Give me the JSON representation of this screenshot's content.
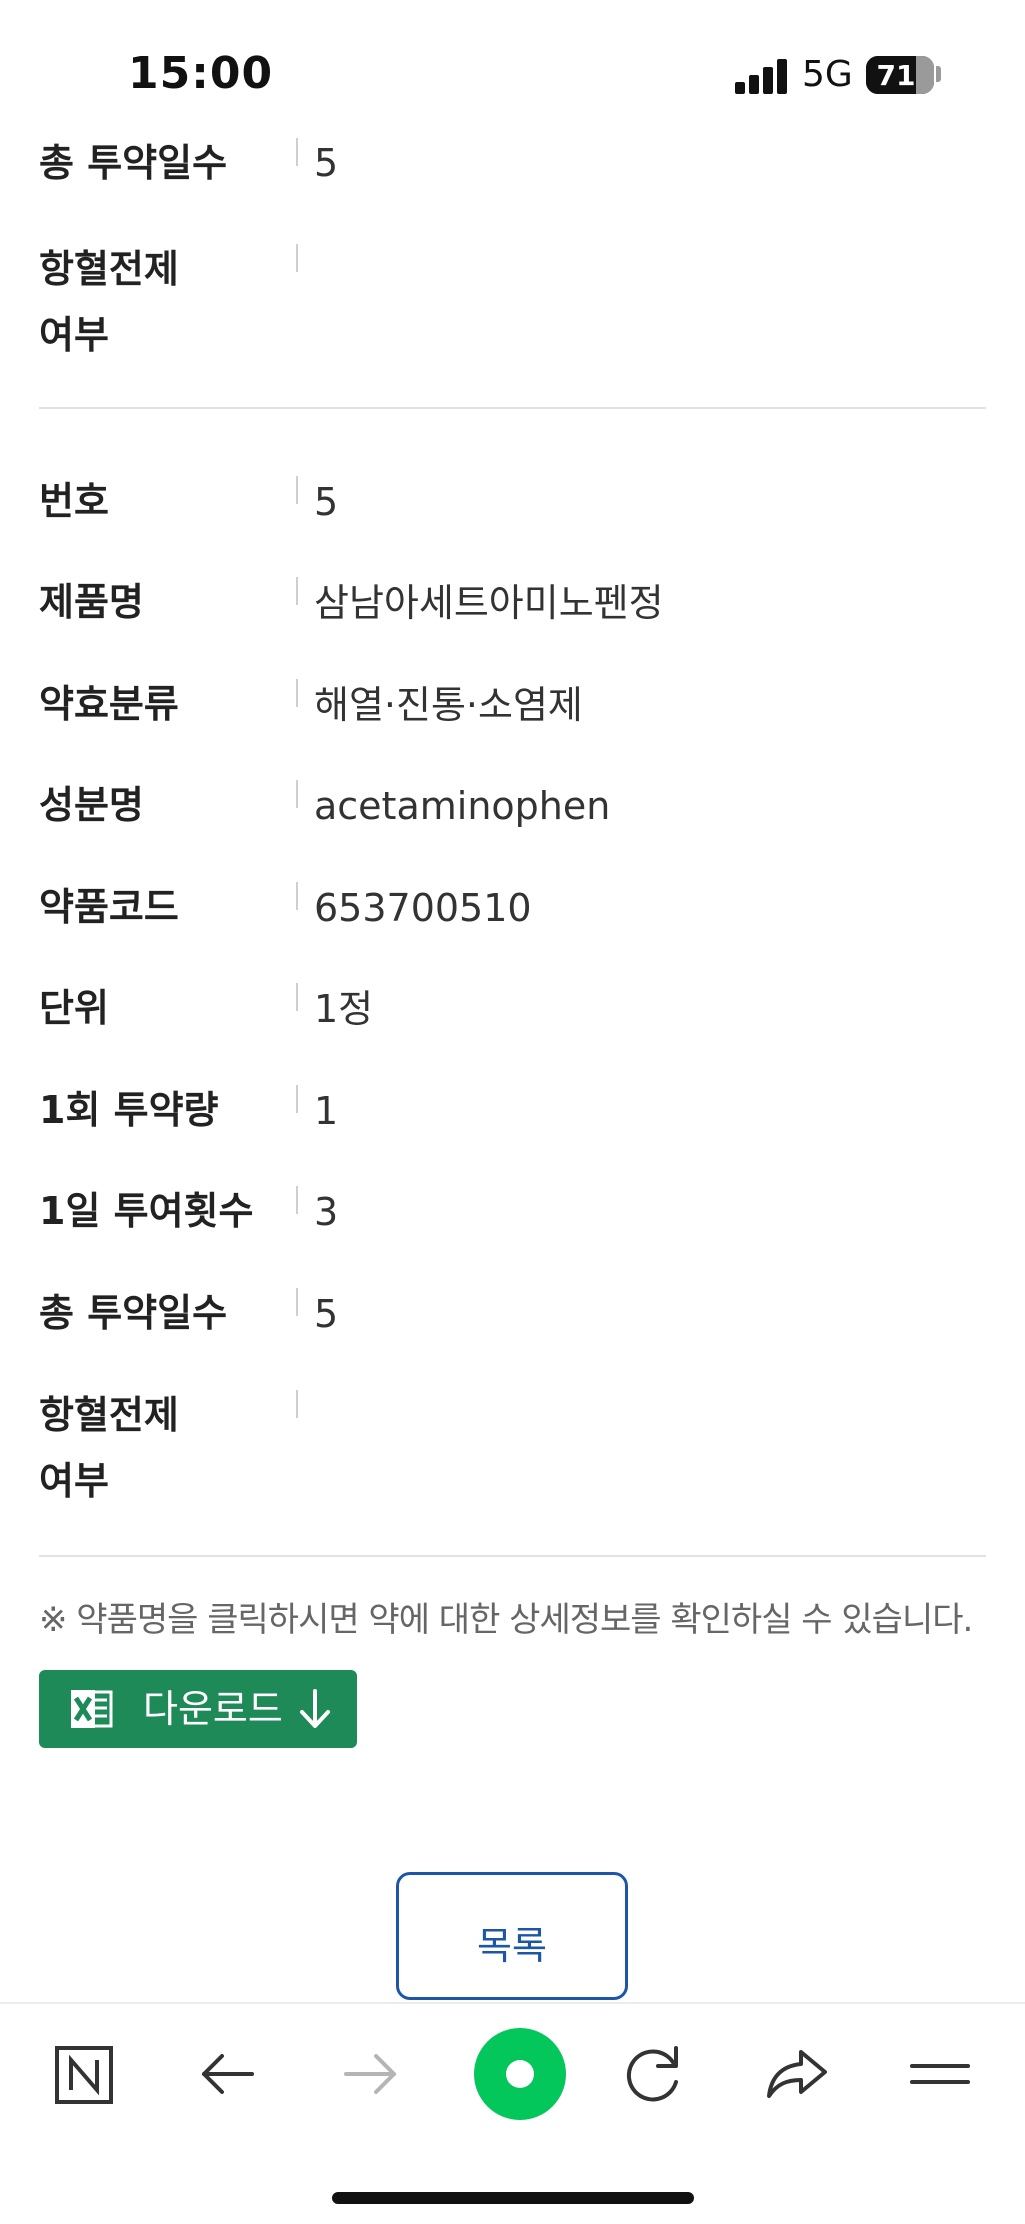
{
  "status_bar": {
    "time": "15:00",
    "network": "5G",
    "battery": "71",
    "battery_level_percent": 71,
    "signal_bars": 4
  },
  "records": [
    {
      "partial": true,
      "fields": [
        {
          "label": "총 투약일수",
          "value": "5"
        },
        {
          "label": "항혈전제\n여부",
          "value": ""
        }
      ]
    },
    {
      "partial": false,
      "fields": [
        {
          "label": "번호",
          "value": "5"
        },
        {
          "label": "제품명",
          "value": "삼남아세트아미노펜정"
        },
        {
          "label": "약효분류",
          "value": "해열·진통·소염제"
        },
        {
          "label": "성분명",
          "value": "acetaminophen"
        },
        {
          "label": "약품코드",
          "value": "653700510"
        },
        {
          "label": "단위",
          "value": "1정"
        },
        {
          "label": "1회 투약량",
          "value": "1"
        },
        {
          "label": "1일 투여횟수",
          "value": "3"
        },
        {
          "label": "총 투약일수",
          "value": "5"
        },
        {
          "label": "항혈전제\n여부",
          "value": ""
        }
      ]
    }
  ],
  "notice": "※ 약품명을 클릭하시면 약에 대한 상세정보를 확인하실 수 있습니다.",
  "download_button": {
    "label": "다운로드"
  },
  "list_button": {
    "label": "목록"
  },
  "bottom_nav": {
    "items": [
      "naver-home-icon",
      "back-arrow-icon",
      "forward-arrow-icon",
      "green-dot-icon",
      "refresh-icon",
      "share-icon",
      "menu-icon"
    ]
  },
  "colors": {
    "download_green": "#1e8a58",
    "list_blue": "#1b57a6",
    "naver_green": "#03c75a"
  }
}
